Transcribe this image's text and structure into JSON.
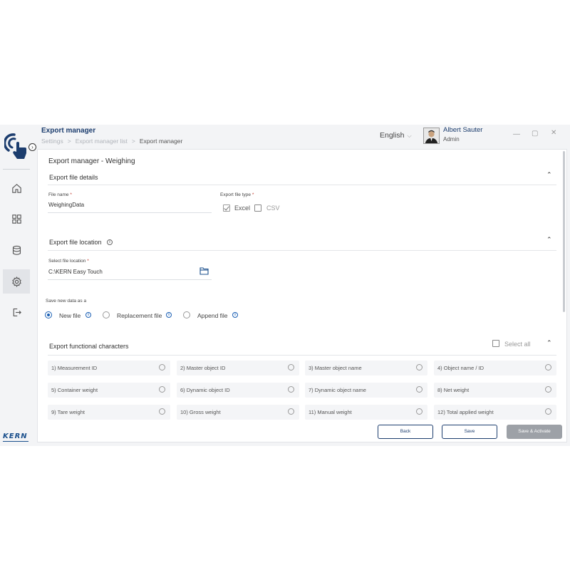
{
  "header": {
    "title": "Export manager",
    "breadcrumb": [
      "Settings",
      "Export manager list",
      "Export manager"
    ],
    "language": "English",
    "user_name": "Albert Sauter",
    "user_role": "Admin"
  },
  "sidebar": {
    "items": [
      {
        "name": "home",
        "icon": "home-icon"
      },
      {
        "name": "dashboard",
        "icon": "grid-icon"
      },
      {
        "name": "database",
        "icon": "database-icon"
      },
      {
        "name": "settings",
        "icon": "gear-icon",
        "active": true
      },
      {
        "name": "logout",
        "icon": "logout-icon"
      }
    ],
    "brand": "KERN"
  },
  "page": {
    "title": "Export manager - Weighing",
    "file_details": {
      "section_title": "Export file details",
      "file_name_label": "File name",
      "file_name_value": "WeighingData",
      "file_type_label": "Export file type",
      "required_mark": "*",
      "types": [
        {
          "label": "Excel",
          "checked": true
        },
        {
          "label": "CSV",
          "checked": false
        }
      ]
    },
    "file_location": {
      "section_title": "Export file location",
      "location_label": "Select file location",
      "location_value": "C:\\KERN Easy Touch"
    },
    "save_as": {
      "label": "Save new data as a",
      "options": [
        {
          "label": "New file",
          "selected": true
        },
        {
          "label": "Replacement file",
          "selected": false
        },
        {
          "label": "Append file",
          "selected": false
        }
      ]
    },
    "functional_characters": {
      "section_title": "Export functional characters",
      "select_all_label": "Select all",
      "items": [
        "1)  Measurement ID",
        "2)  Master object ID",
        "3)  Master object name",
        "4)  Object name / ID",
        "5)  Container weight",
        "6)  Dynamic object ID",
        "7)  Dynamic object name",
        "8)  Net weight",
        "9)  Tare weight",
        "10)  Gross weight",
        "11)  Manual weight",
        "12)  Total applied weight"
      ]
    },
    "buttons": {
      "back": "Back",
      "save": "Save",
      "save_activate": "Save & Activate"
    }
  },
  "colors": {
    "brand": "#1c3d6e",
    "accent": "#1a5fb4",
    "disabled_button": "#9da1a7"
  }
}
